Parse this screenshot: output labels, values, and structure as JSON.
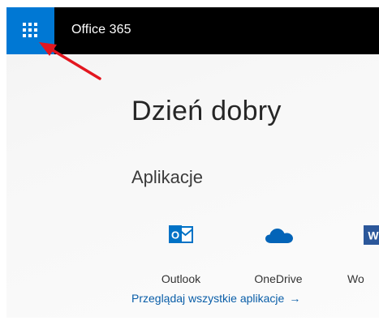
{
  "header": {
    "app_title": "Office 365",
    "launcher_icon": "waffle-app-launcher-icon"
  },
  "main": {
    "greeting": "Dzień dobry",
    "apps_section_title": "Aplikacje",
    "apps": [
      {
        "label": "Outlook",
        "icon": "outlook-icon",
        "icon_letter": "O",
        "color": "#0072c6"
      },
      {
        "label": "OneDrive",
        "icon": "onedrive-icon",
        "color": "#0364b8"
      },
      {
        "label": "Wo",
        "icon": "word-icon",
        "icon_letter": "W",
        "color": "#2b579a"
      }
    ],
    "browse_all_link": "Przeglądaj wszystkie aplikacje",
    "browse_all_arrow": "→"
  },
  "colors": {
    "topbar": "#000000",
    "launcher": "#0078d4",
    "link": "#0a5ea8",
    "annotation_arrow": "#e3161f"
  }
}
